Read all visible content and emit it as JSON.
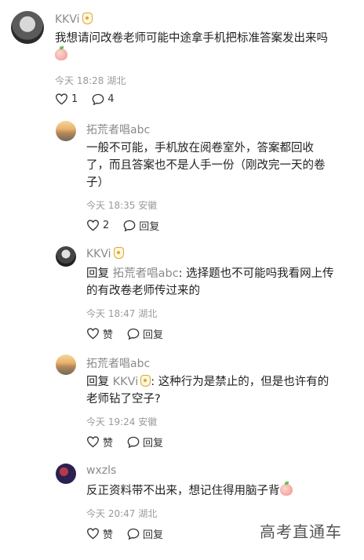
{
  "main_comment": {
    "user": "KKVi",
    "text": "我想请问改卷老师可能中途拿手机把标准答案发出来吗",
    "time": "今天 18:28",
    "location": "湖北",
    "likes": "1",
    "replies": "4"
  },
  "replies": [
    {
      "user": "拓荒者唱abc",
      "line1": "一般不可能，手机放在阅卷室外，答案都回收",
      "line2": "了，而且答案也不是人手一份（刚改完一天的卷",
      "line3": "子）",
      "time": "今天 18:35",
      "location": "安徽",
      "likes": "2",
      "reply_label": "回复"
    },
    {
      "user": "KKVi",
      "reply_prefix": "回复",
      "mention": "拓荒者唱abc",
      "line1_rest": ": 选择题也不可能吗我看网上传",
      "line2": "的有改卷老师传过来的",
      "time": "今天 18:47",
      "location": "湖北",
      "like_label": "赞",
      "reply_label": "回复"
    },
    {
      "user": "拓荒者唱abc",
      "reply_prefix": "回复",
      "mention": "KKVi",
      "line1_rest": ": 这种行为是禁止的，但是也许有的",
      "line2": "老师钻了空子?",
      "time": "今天 19:24",
      "location": "安徽",
      "like_label": "赞",
      "reply_label": "回复"
    },
    {
      "user": "wxzls",
      "line1": "反正资料带不出来，想记住得用脑子背",
      "time": "今天 20:47",
      "location": "湖北",
      "like_label": "赞",
      "reply_label": "回复"
    }
  ],
  "watermark": "高考直通车"
}
